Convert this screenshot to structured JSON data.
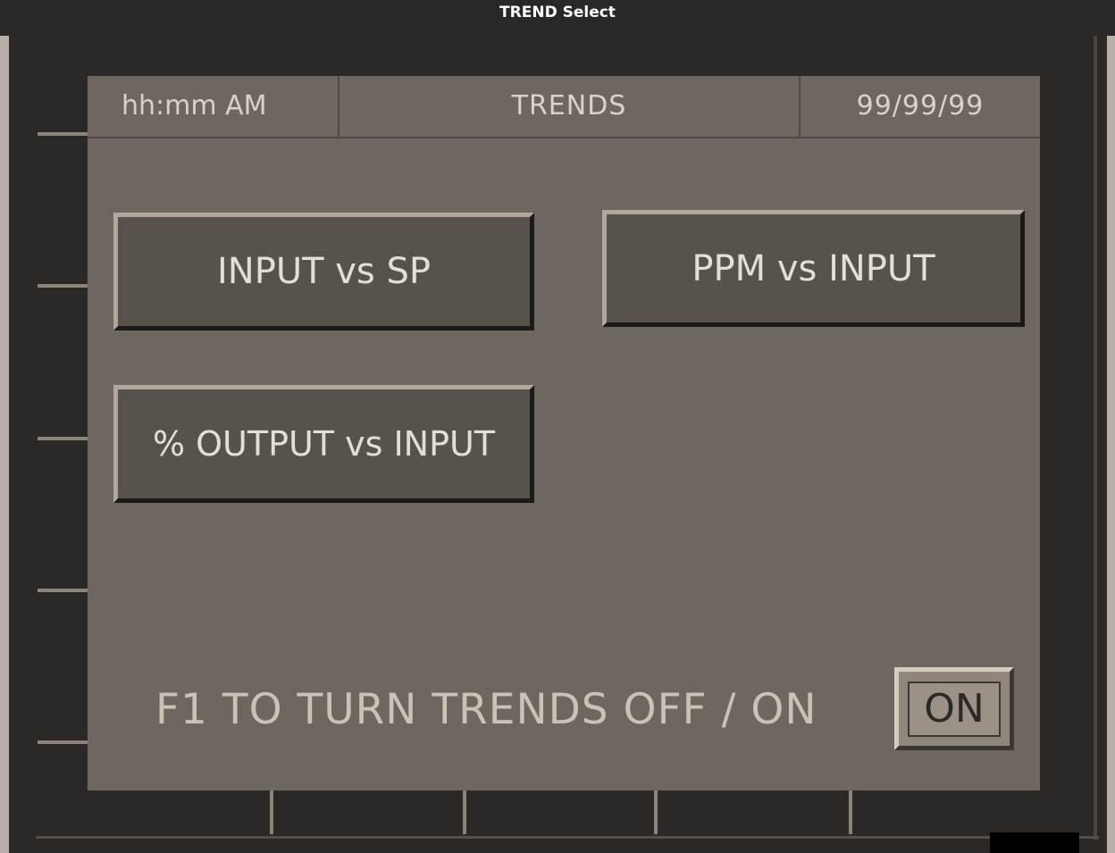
{
  "window": {
    "title": "TREND Select"
  },
  "header": {
    "time": "hh:mm AM",
    "title": "TRENDS",
    "date": "99/99/99"
  },
  "buttons": {
    "input_vs_sp": "INPUT vs SP",
    "ppm_vs_input": "PPM vs INPUT",
    "output_vs_input": "% OUTPUT vs INPUT"
  },
  "footer": {
    "instruction": "F1 TO TURN TRENDS OFF / ON",
    "toggle_state": "ON"
  },
  "colors": {
    "bezel": "#2b2826",
    "screen": "#6d675f",
    "button_face": "#58524c",
    "text": "#e4dfd6"
  }
}
